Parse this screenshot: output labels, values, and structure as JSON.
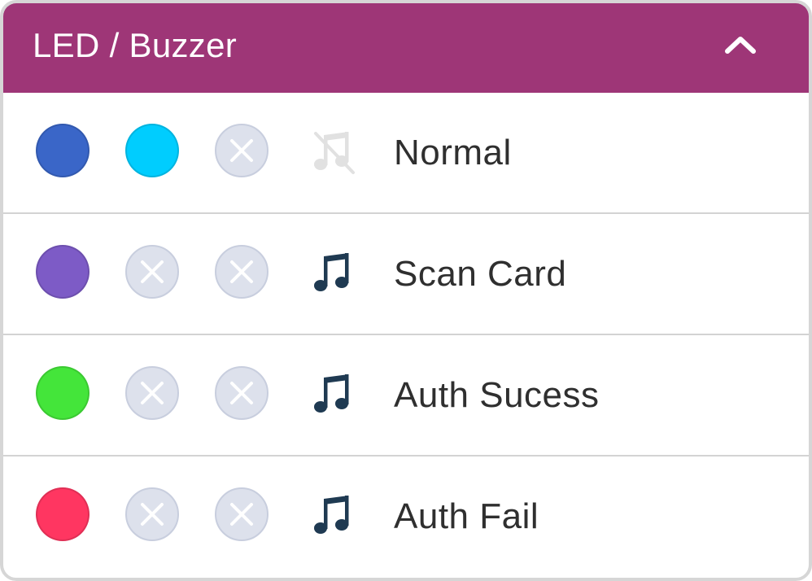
{
  "header": {
    "title": "LED / Buzzer",
    "collapse_icon": "chevron-up-icon",
    "background": "#9e3677"
  },
  "rows": [
    {
      "label": "Normal",
      "colors": [
        "#3a66c8",
        "#00cdfe",
        null
      ],
      "buzzer": "music-off-icon",
      "buzzer_color": "#e1e1e1"
    },
    {
      "label": "Scan Card",
      "colors": [
        "#7d5bc6",
        null,
        null
      ],
      "buzzer": "music-note-icon",
      "buzzer_color": "#1f3a52"
    },
    {
      "label": "Auth Sucess",
      "colors": [
        "#44e53a",
        null,
        null
      ],
      "buzzer": "music-note-icon",
      "buzzer_color": "#1f3a52"
    },
    {
      "label": "Auth Fail",
      "colors": [
        "#ff3661",
        null,
        null
      ],
      "buzzer": "music-note-icon",
      "buzzer_color": "#1f3a52"
    }
  ],
  "empty_slot_icon": "close-icon"
}
